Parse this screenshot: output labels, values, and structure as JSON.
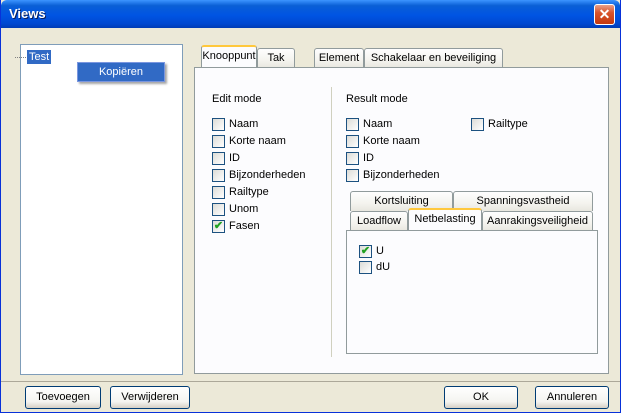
{
  "window": {
    "title": "Views",
    "close_label": "✕"
  },
  "tree": {
    "node_label": "Test"
  },
  "context_menu": {
    "item_label": "Kopiëren"
  },
  "main_tabs": [
    "Knooppunt",
    "Tak",
    "Element",
    "Schakelaar en beveiliging"
  ],
  "edit_mode": {
    "heading": "Edit mode",
    "items": [
      {
        "label": "Naam",
        "checked": false
      },
      {
        "label": "Korte naam",
        "checked": false
      },
      {
        "label": "ID",
        "checked": false
      },
      {
        "label": "Bijzonderheden",
        "checked": false
      },
      {
        "label": "Railtype",
        "checked": false
      },
      {
        "label": "Unom",
        "checked": false
      },
      {
        "label": "Fasen",
        "checked": true
      }
    ]
  },
  "result_mode": {
    "heading": "Result mode",
    "items": [
      {
        "label": "Naam",
        "checked": false
      },
      {
        "label": "Korte naam",
        "checked": false
      },
      {
        "label": "ID",
        "checked": false
      },
      {
        "label": "Bijzonderheden",
        "checked": false
      }
    ],
    "railtype": {
      "label": "Railtype",
      "checked": false
    }
  },
  "result_tabs": {
    "row_top": [
      "Kortsluiting",
      "Spanningsvastheid"
    ],
    "row_bottom": [
      "Loadflow",
      "Netbelasting",
      "Aanrakingsveiligheid"
    ],
    "active": "Netbelasting"
  },
  "netbelasting": {
    "items": [
      {
        "label": "U",
        "checked": true
      },
      {
        "label": "dU",
        "checked": false
      }
    ]
  },
  "buttons": {
    "add": "Toevoegen",
    "remove": "Verwijderen",
    "ok": "OK",
    "cancel": "Annuleren"
  },
  "colors": {
    "titlebar": "#0054e3",
    "selection": "#316ac5",
    "active_tab_accent": "#ffc83c",
    "checkmark": "#21a121"
  }
}
